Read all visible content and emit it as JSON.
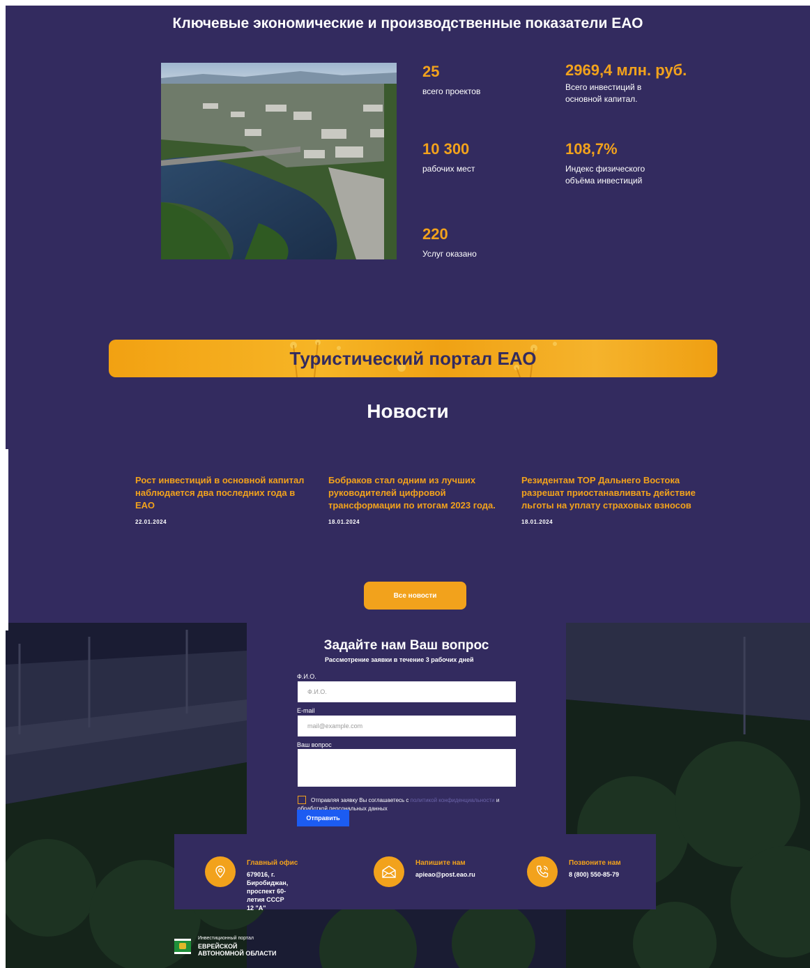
{
  "stats": {
    "title": "Ключевые экономические и производственные показатели ЕАО",
    "items": [
      {
        "value": "25",
        "label": "всего проектов"
      },
      {
        "value": "2969,4 млн. руб.",
        "label": "Всего инвестиций в основной капитал."
      },
      {
        "value": "10 300",
        "label": "рабочих мест"
      },
      {
        "value": "108,7%",
        "label": "Индекс физического объёма инвестиций"
      },
      {
        "value": "220",
        "label": "Услуг оказано"
      }
    ]
  },
  "tourist": {
    "title": "Туристический портал ЕАО"
  },
  "news": {
    "heading": "Новости",
    "items": [
      {
        "title": "Рост инвестиций в основной капитал наблюдается два последних года в ЕАО",
        "date": "22.01.2024"
      },
      {
        "title": "Бобраков стал одним из лучших руководителей цифровой трансформации по итогам 2023 года.",
        "date": "18.01.2024"
      },
      {
        "title": "Резидентам ТОР Дальнего Востока разрешат приостанавливать действие льготы на уплату страховых взносов",
        "date": "18.01.2024"
      }
    ],
    "all_label": "Все новости"
  },
  "form": {
    "title": "Задайте нам Ваш вопрос",
    "subtitle": "Рассмотрение заявки в течение 3 рабочих дней",
    "name_label": "Ф.И.О.",
    "name_placeholder": "Ф.И.О.",
    "email_label": "E-mail",
    "email_placeholder": "mail@example.com",
    "question_label": "Ваш вопрос",
    "consent_prefix": "Отправляя заявку Вы соглашаетесь с ",
    "consent_link": "политикой конфиденциальности",
    "consent_suffix": " и обработкой персональных данных",
    "submit_label": "Отправить"
  },
  "contacts": [
    {
      "title": "Главный офис",
      "text": "679016, г. Биробиджан,\nпроспект 60-летия СССР 12 \"А\"",
      "icon": "map-pin-icon"
    },
    {
      "title": "Напишите нам",
      "text": "apieao@post.eao.ru",
      "icon": "envelope-icon"
    },
    {
      "title": "Позвоните нам",
      "text": "8 (800) 550-85-79",
      "icon": "phone-icon"
    }
  ],
  "footer": {
    "logo_small": "Инвестиционный портал",
    "logo_big": "ЕВРЕЙСКОЙ АВТОНОМНОЙ ОБЛАСТИ"
  },
  "colors": {
    "background": "#332b5f",
    "accent": "#f2a21c",
    "button_blue": "#1c5cf2"
  }
}
